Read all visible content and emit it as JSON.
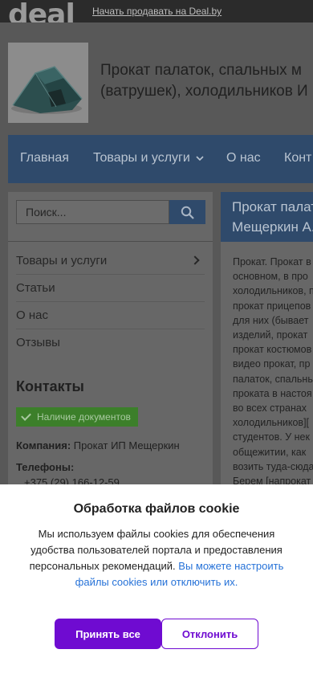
{
  "topbar": {
    "logo": "deal",
    "sell_link": "Начать продавать на Deal.by"
  },
  "header": {
    "title_line1": "Прокат палаток, спальных м",
    "title_line2": "(ватрушек), холодильников И"
  },
  "nav": {
    "items": [
      {
        "label": "Главная"
      },
      {
        "label": "Товары и услуги"
      },
      {
        "label": "О нас"
      },
      {
        "label": "Конт"
      }
    ]
  },
  "sidebar": {
    "search_placeholder": "Поиск...",
    "menu": [
      {
        "label": "Товары и услуги"
      },
      {
        "label": "Статьи"
      },
      {
        "label": "О нас"
      },
      {
        "label": "Отзывы"
      }
    ],
    "contacts_title": "Контакты",
    "docs_badge": "Наличие документов",
    "company_label": "Компания:",
    "company_value": "Прокат ИП Мещеркин",
    "phones_label": "Телефоны:",
    "phone1": "+375 (29) 166-12-59"
  },
  "main": {
    "heading_line1": "Прокат палат",
    "heading_line2": "Мещеркин А.",
    "body_lines": [
      "Прокат. Прокат в",
      "основном, в про",
      "холодильников, п",
      "прокат прицепов",
      "для них (бывает",
      "изделий, прокат",
      "прокат костюмов",
      "видео прокат, пр",
      "палаток, спальнь",
      "проката в настоя",
      "во всех странах",
      "холодильников][",
      "студентов. У нек",
      "общежитии, как",
      "возить туда-сюда",
      "Берем [напрокат"
    ]
  },
  "cookie": {
    "title": "Обработка файлов cookie",
    "text": "Мы используем файлы cookies для обеспечения удобства пользователей портала и предоставления персональных рекомендаций.",
    "link": "Вы можете настроить файлы cookies или отключить их.",
    "accept": "Принять все",
    "reject": "Отклонить"
  },
  "colors": {
    "nav_bg": "#2f4a6b",
    "accent_purple": "#6f0bd1",
    "badge_green": "#3c7f2a",
    "link_blue": "#2672d8"
  }
}
